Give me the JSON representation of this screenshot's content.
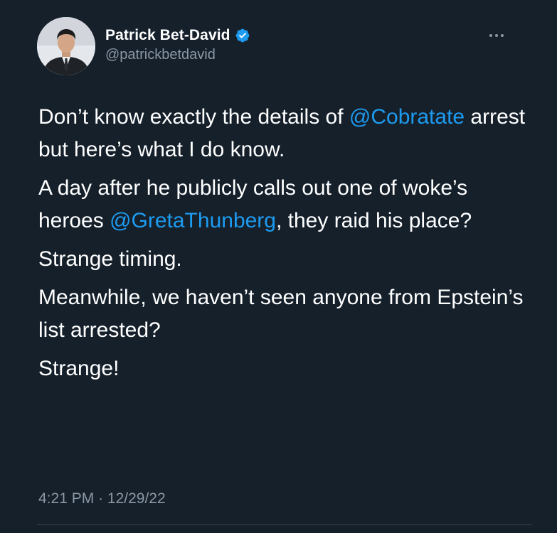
{
  "author": {
    "display_name": "Patrick Bet-David",
    "handle": "@patrickbetdavid",
    "verified": true,
    "avatar_icon": "profile-photo",
    "verified_icon": "verified-badge-icon",
    "verified_color": "#1d9bf0"
  },
  "more_icon": "more-horizontal-icon",
  "tweet": {
    "p1": {
      "t1": "Don’t know exactly the details of ",
      "m1": "@Cobratate",
      "t2": " arrest but here’s what I do know."
    },
    "p2": {
      "t1": "A day after he publicly calls out one of woke’s heroes ",
      "m1": "@GretaThunberg",
      "t2": ", they raid his place?"
    },
    "p3": "Strange timing.",
    "p4": "Meanwhile, we haven’t seen anyone from Epstein’s list arrested?",
    "p5": "Strange!"
  },
  "meta": {
    "time": "4:21 PM",
    "separator": "·",
    "date": "12/29/22"
  },
  "colors": {
    "background": "#15202b",
    "text": "#ffffff",
    "secondary": "#8b98a5",
    "link": "#1d9bf0"
  }
}
